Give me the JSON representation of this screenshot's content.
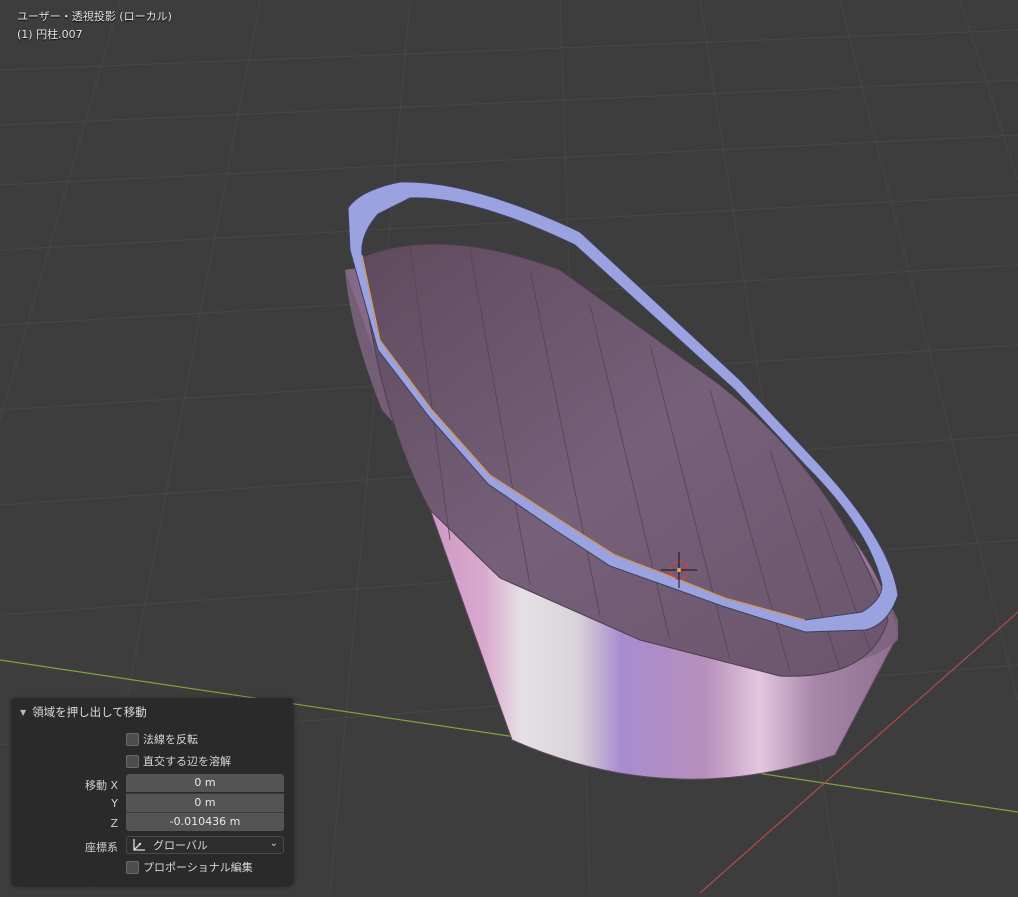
{
  "viewport": {
    "view_name": "ユーザー・透視投影 (ローカル)",
    "object_name": "(1) 円柱.007"
  },
  "panel": {
    "title": "領域を押し出して移動",
    "flip_normals": "法線を反転",
    "dissolve_edges": "直交する辺を溶解",
    "move_x_label": "移動 X",
    "move_x_value": "0 m",
    "move_y_label": "Y",
    "move_y_value": "0 m",
    "move_z_label": "Z",
    "move_z_value": "-0.010436 m",
    "orientation_label": "座標系",
    "orientation_value": "グローバル",
    "proportional": "プロポーショナル編集"
  },
  "colors": {
    "background": "#3d3d3d",
    "grid": "#474747",
    "axis_x": "#b54a4a",
    "axis_y": "#7ea43c",
    "selection": "#8c93d8",
    "mesh": "#b28ab2"
  },
  "icons": {
    "orientation": "axes-icon",
    "collapse": "triangle-down-icon",
    "chevron": "chevron-down-icon",
    "cursor": "3d-cursor-icon"
  }
}
